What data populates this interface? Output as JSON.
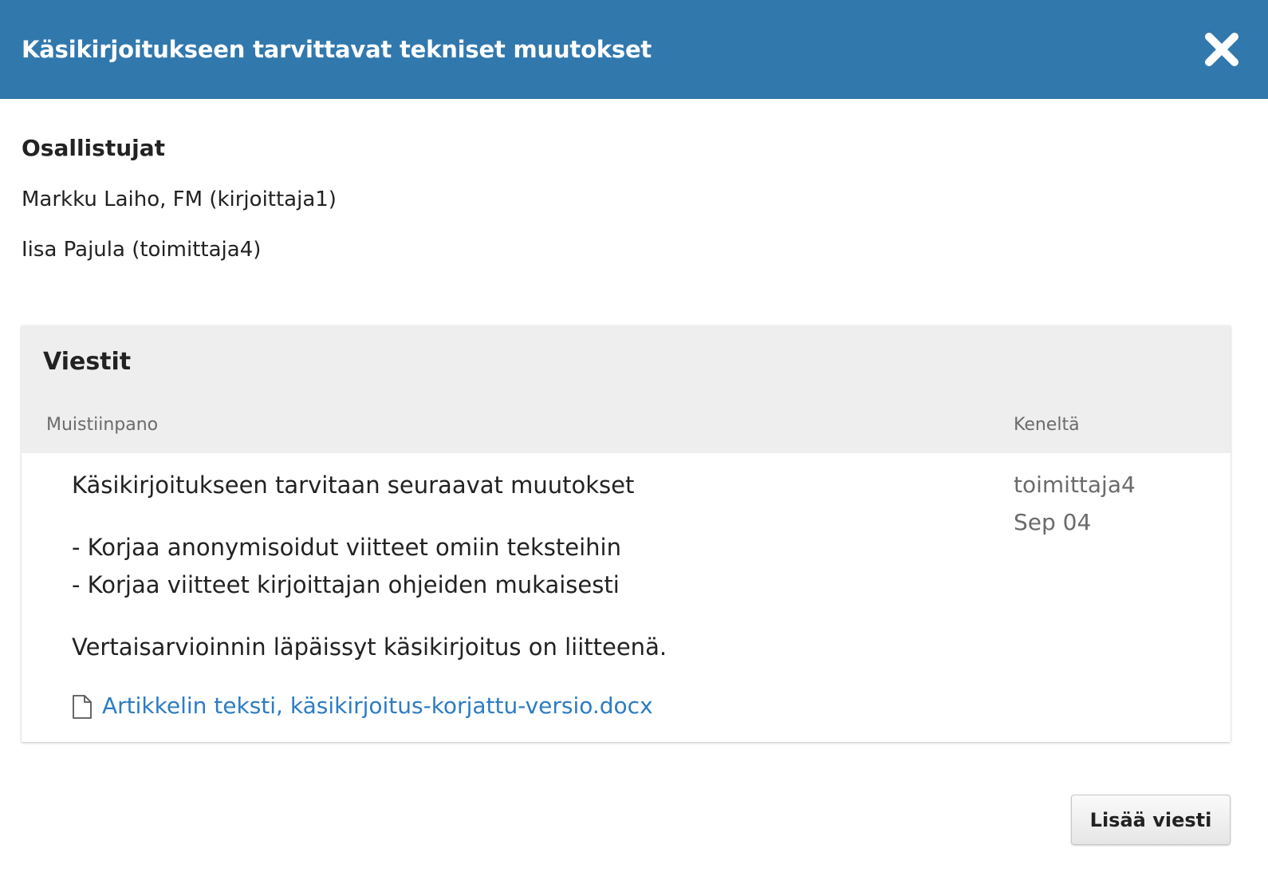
{
  "modal": {
    "title": "Käsikirjoitukseen tarvittavat tekniset muutokset",
    "close_icon": "close-icon",
    "header_color": "#3178ad"
  },
  "participants": {
    "heading": "Osallistujat",
    "items": [
      "Markku Laiho, FM (kirjoittaja1)",
      "Iisa Pajula (toimittaja4)"
    ]
  },
  "messages": {
    "title": "Viestit",
    "columns": {
      "note": "Muistiinpano",
      "from": "Keneltä"
    },
    "items": [
      {
        "lines": [
          "Käsikirjoitukseen tarvitaan seuraavat muutokset",
          "- Korjaa anonymisoidut viitteet omiin teksteihin",
          "- Korjaa viitteet kirjoittajan ohjeiden mukaisesti",
          "Vertaisarvioinnin läpäissyt käsikirjoitus on liitteenä."
        ],
        "attachment": {
          "icon": "file-icon",
          "label": "Artikkelin teksti, käsikirjoitus-korjattu-versio.docx"
        },
        "from": "toimittaja4",
        "date": "Sep 04"
      }
    ]
  },
  "footer": {
    "add_message_label": "Lisää viesti"
  }
}
